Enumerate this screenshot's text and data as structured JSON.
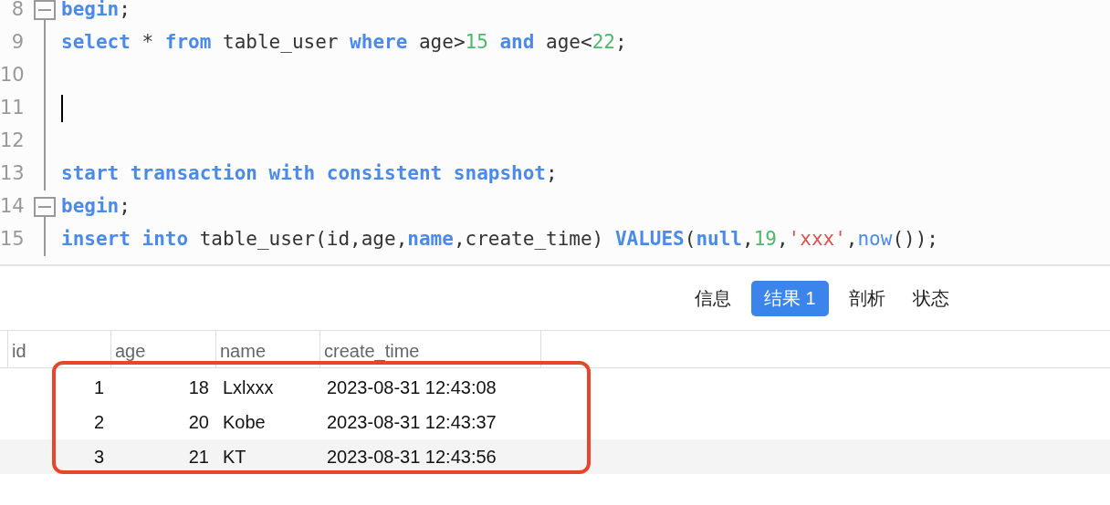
{
  "editor": {
    "lines": [
      {
        "number": "8",
        "fold": true,
        "cursor": false,
        "tokens": [
          {
            "kind": "keyword",
            "text": "begin"
          },
          {
            "kind": "plain",
            "text": ";"
          }
        ]
      },
      {
        "number": "9",
        "fold": false,
        "cursor": false,
        "tokens": [
          {
            "kind": "keyword",
            "text": "select"
          },
          {
            "kind": "plain",
            "text": " * "
          },
          {
            "kind": "keyword",
            "text": "from"
          },
          {
            "kind": "plain",
            "text": " table_user "
          },
          {
            "kind": "keyword",
            "text": "where"
          },
          {
            "kind": "plain",
            "text": " age>"
          },
          {
            "kind": "number",
            "text": "15"
          },
          {
            "kind": "keyword",
            "text": " and"
          },
          {
            "kind": "plain",
            "text": " age<"
          },
          {
            "kind": "number",
            "text": "22"
          },
          {
            "kind": "plain",
            "text": ";"
          }
        ]
      },
      {
        "number": "10",
        "fold": false,
        "cursor": false
      },
      {
        "number": "11",
        "fold": false,
        "cursor": true
      },
      {
        "number": "12",
        "fold": false,
        "cursor": false
      },
      {
        "number": "13",
        "fold": false,
        "cursor": false,
        "tokens": [
          {
            "kind": "keyword",
            "text": "start transaction with consistent snapshot"
          },
          {
            "kind": "plain",
            "text": ";"
          }
        ]
      },
      {
        "number": "14",
        "fold": true,
        "cursor": false,
        "tokens": [
          {
            "kind": "keyword",
            "text": "begin"
          },
          {
            "kind": "plain",
            "text": ";"
          }
        ]
      },
      {
        "number": "15",
        "fold": false,
        "cursor": false,
        "tokens": [
          {
            "kind": "keyword",
            "text": "insert into"
          },
          {
            "kind": "plain",
            "text": " table_user(id,age,"
          },
          {
            "kind": "keyword",
            "text": "name"
          },
          {
            "kind": "plain",
            "text": ",create_time) "
          },
          {
            "kind": "keyword",
            "text": "VALUES"
          },
          {
            "kind": "plain",
            "text": "("
          },
          {
            "kind": "keyword",
            "text": "null"
          },
          {
            "kind": "plain",
            "text": ","
          },
          {
            "kind": "number",
            "text": "19"
          },
          {
            "kind": "plain",
            "text": ","
          },
          {
            "kind": "string",
            "text": "'xxx'"
          },
          {
            "kind": "plain",
            "text": ","
          },
          {
            "kind": "function",
            "text": "now"
          },
          {
            "kind": "plain",
            "text": "());"
          }
        ]
      }
    ]
  },
  "tabs": [
    {
      "label": "信息",
      "selected": false
    },
    {
      "label": "结果 1",
      "selected": true
    },
    {
      "label": "剖析",
      "selected": false
    },
    {
      "label": "状态",
      "selected": false
    }
  ],
  "table": {
    "columns": [
      "id",
      "age",
      "name",
      "create_time"
    ],
    "rows": [
      {
        "cells": [
          "1",
          "18",
          "Lxlxxx",
          "2023-08-31 12:43:08"
        ]
      },
      {
        "cells": [
          "2",
          "20",
          "Kobe",
          "2023-08-31 12:43:37"
        ]
      },
      {
        "cells": [
          "3",
          "21",
          "KT",
          "2023-08-31 12:43:56"
        ]
      }
    ]
  }
}
